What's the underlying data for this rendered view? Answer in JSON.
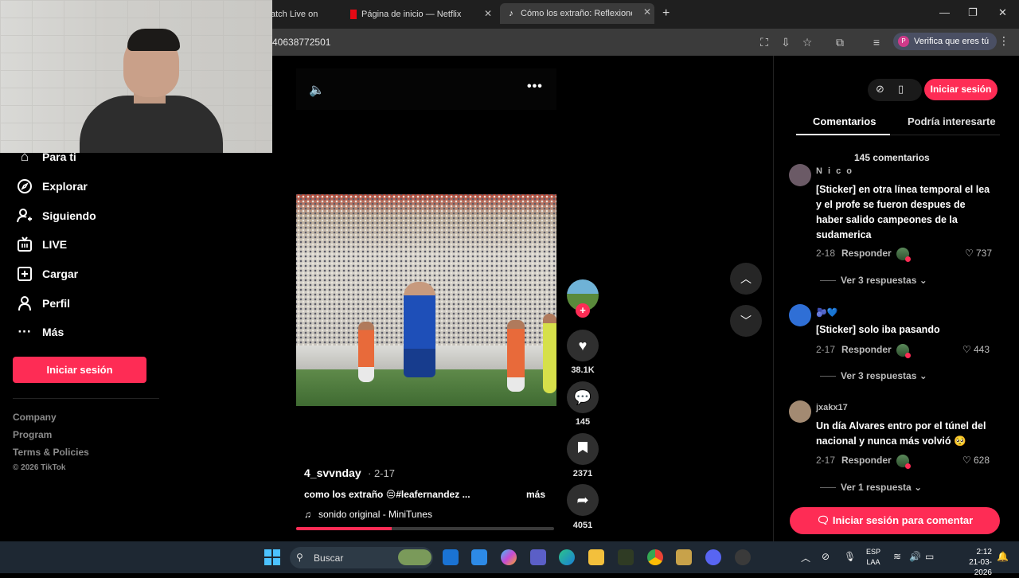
{
  "browser": {
    "tabs": [
      {
        "label": "atch Live on",
        "active": false
      },
      {
        "label": "Página de inicio — Netflix",
        "active": false
      },
      {
        "label": "Cómo los extraño: Reflexiones c",
        "active": true
      }
    ],
    "new_tab_icon": "+",
    "url": "40638772501",
    "verify_label": "Verifica que eres tú",
    "verify_initial": "P"
  },
  "sidebar": {
    "items": [
      {
        "label": "Para ti",
        "icon": "home-icon"
      },
      {
        "label": "Explorar",
        "icon": "compass-icon"
      },
      {
        "label": "Siguiendo",
        "icon": "user-follow-icon"
      },
      {
        "label": "LIVE",
        "icon": "live-tv-icon"
      },
      {
        "label": "Cargar",
        "icon": "upload-plus-icon"
      },
      {
        "label": "Perfil",
        "icon": "profile-icon"
      },
      {
        "label": "Más",
        "icon": "more-dots-icon"
      }
    ],
    "login_label": "Iniciar sesión",
    "footer_links": [
      "Company",
      "Program",
      "Terms & Policies"
    ],
    "copyright": "© 2026 TikTok"
  },
  "video": {
    "author": "4_svvnday",
    "date": "· 2-17",
    "caption": "como los extraño 😔#leafernandez ...",
    "more_label": "más",
    "music": "sonido original - MiniTunes",
    "progress": 0.37
  },
  "actions": {
    "likes": "38.1K",
    "comments": "145",
    "saves": "2371",
    "shares": "4051"
  },
  "right_panel": {
    "login_label": "Iniciar sesión",
    "tabs": [
      "Comentarios",
      "Podría interesarte"
    ],
    "comment_count": "145 comentarios",
    "reply_label": "Responder",
    "comments": [
      {
        "user": "N i c o",
        "text": "[Sticker] en otra línea temporal el lea y el profe se fueron despues de haber salido campeones de la sudamerica",
        "date": "2-18",
        "likes": "737",
        "more": "Ver 3 respuestas",
        "avatar_color": "#6b5a66"
      },
      {
        "user": "🫐💙",
        "text": "[Sticker] solo iba pasando",
        "date": "2-17",
        "likes": "443",
        "more": "Ver 3 respuestas",
        "avatar_color": "#2f6fd6"
      },
      {
        "user": "jxakx17",
        "text": "Un día Alvares entro por el túnel del nacional y nunca más volvió 🥺",
        "date": "2-17",
        "likes": "628",
        "more": "Ver 1 respuesta",
        "avatar_color": "#a38a72"
      }
    ],
    "comment_button": "Iniciar sesión para comentar"
  },
  "taskbar": {
    "search_label": "Buscar",
    "lang_line1": "ESP",
    "lang_line2": "LAA",
    "time": "2:12",
    "date": "21-03-2026"
  },
  "colors": {
    "accent": "#fe2c55",
    "background": "#000000",
    "chrome_dark": "#1f1f1f",
    "taskbar": "#1e2833"
  }
}
